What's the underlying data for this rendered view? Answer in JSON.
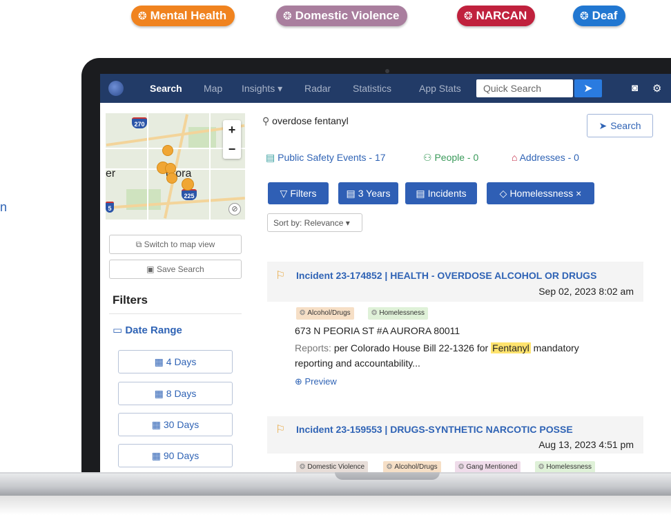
{
  "tags": [
    {
      "label": "Mental Health",
      "color": "#f0831f"
    },
    {
      "label": "Domestic Violence",
      "color": "#a97e9e"
    },
    {
      "label": "NARCAN",
      "color": "#c0213d"
    },
    {
      "label": "Deaf",
      "color": "#2177d1"
    }
  ],
  "side_fragment": "n",
  "navbar": {
    "items": [
      "Search",
      "Map",
      "Insights ▾",
      "Radar",
      "Statistics",
      "App Stats"
    ],
    "quick_search_placeholder": "Quick Search",
    "quick_search_button": "➤"
  },
  "map": {
    "label_left": "er",
    "label_city": "urora",
    "shield_top": "270",
    "shield_mid": "225",
    "shield_left": "5",
    "zoom_in": "+",
    "zoom_out": "−"
  },
  "sidebar": {
    "switch_map": "Switch to map view",
    "save_search": "Save Search",
    "filters_heading": "Filters",
    "date_range": "Date Range",
    "day_buttons": [
      "4 Days",
      "8 Days",
      "30 Days",
      "90 Days"
    ]
  },
  "search": {
    "query": "overdose fentanyl",
    "button": "Search"
  },
  "tabs": [
    {
      "label": "Public Safety Events - 17"
    },
    {
      "label": "People - 0"
    },
    {
      "label": "Addresses - 0"
    }
  ],
  "filter_chips": [
    "Filters",
    "3 Years",
    "Incidents",
    "Homelessness ×"
  ],
  "sort": "Sort by: Relevance ▾",
  "results": [
    {
      "title": "Incident 23-174852 | HEALTH - OVERDOSE ALCOHOL OR DRUGS",
      "date": "Sep 02, 2023 8:02 am",
      "tags": [
        "Alcohol/Drugs",
        "Homelessness"
      ],
      "address": "673 N PEORIA ST #A AURORA 80011",
      "report_label": "Reports:",
      "report_pre": "per Colorado House Bill 22-1326 for",
      "report_highlight": "Fentanyl",
      "report_post": "mandatory reporting and accountability...",
      "preview": "Preview"
    },
    {
      "title": "Incident 23-159553 | DRUGS-SYNTHETIC NARCOTIC POSSE",
      "date": "Aug 13, 2023 4:51 pm",
      "tags": [
        "Domestic Violence",
        "Alcohol/Drugs",
        "Gang Mentioned",
        "Homelessness"
      ]
    }
  ]
}
